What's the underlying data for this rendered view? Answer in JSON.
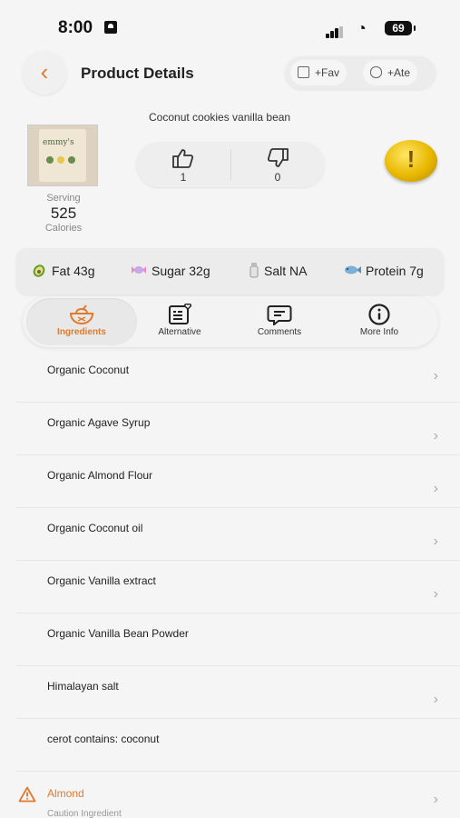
{
  "status_bar": {
    "time": "8:00",
    "battery": "69"
  },
  "header": {
    "title": "Product Details",
    "fav_label": "+Fav",
    "ate_label": "+Ate"
  },
  "product": {
    "name": "Coconut cookies vanilla bean",
    "image_brand": "emmy's",
    "serving_label": "Serving",
    "calories": "525",
    "calories_label": "Calories",
    "likes": "1",
    "dislikes": "0"
  },
  "nutrition": {
    "fat": "Fat 43g",
    "sugar": "Sugar 32g",
    "salt": "Salt NA",
    "protein": "Protein 7g"
  },
  "tabs": [
    {
      "label": "Ingredients",
      "icon": "bowl-icon",
      "active": true
    },
    {
      "label": "Alternative",
      "icon": "list-heart-icon",
      "active": false
    },
    {
      "label": "Comments",
      "icon": "chat-bubble-icon",
      "active": false
    },
    {
      "label": "More Info",
      "icon": "info-icon",
      "active": false
    }
  ],
  "ingredients": [
    "Organic Coconut",
    "Organic Agave Syrup",
    "Organic Almond Flour",
    "Organic Coconut oil",
    "Organic Vanilla extract",
    "Organic Vanilla Bean Powder",
    "Himalayan salt",
    "cerot contains: coconut"
  ],
  "caution": {
    "name": "Almond",
    "subtitle": "Caution Ingredient"
  },
  "colors": {
    "accent": "#e07a2c",
    "background": "#f5f5f5",
    "warning_coin": "#e8b800"
  }
}
